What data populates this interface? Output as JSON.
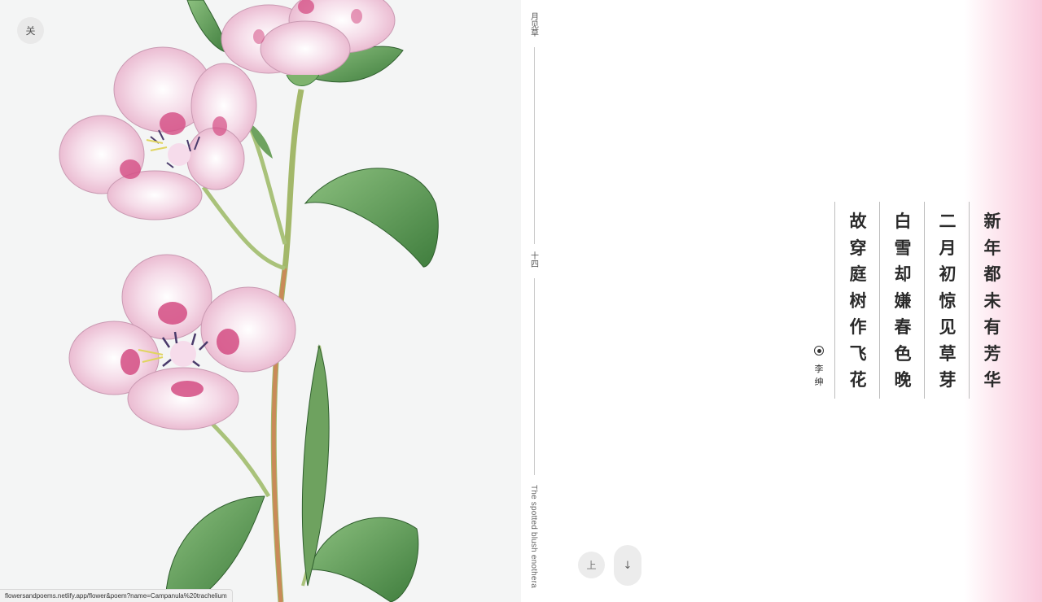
{
  "controls": {
    "close_label": "关",
    "prev_label": "上",
    "next_icon": "↓"
  },
  "status_url": "flowersandpoems.netlify.app/flower&poem?name=Campanula%20trachelium",
  "meta": {
    "series_title": [
      "月",
      "见",
      "草"
    ],
    "number": [
      "十",
      "四"
    ],
    "flower_name_en": "The spotted blush enothera"
  },
  "poem": {
    "lines": [
      [
        "新",
        "年",
        "都",
        "未",
        "有",
        "芳",
        "华"
      ],
      [
        "二",
        "月",
        "初",
        "惊",
        "见",
        "草",
        "芽"
      ],
      [
        "白",
        "雪",
        "却",
        "嫌",
        "春",
        "色",
        "晚"
      ],
      [
        "故",
        "穿",
        "庭",
        "树",
        "作",
        "飞",
        "花"
      ]
    ],
    "author": [
      "李",
      "绅"
    ]
  },
  "colors": {
    "accent_pink": "#f9c9dc",
    "petal_pink": "#f2c9dc",
    "petal_magenta": "#d44c83",
    "leaf_green": "#5a9a56"
  }
}
